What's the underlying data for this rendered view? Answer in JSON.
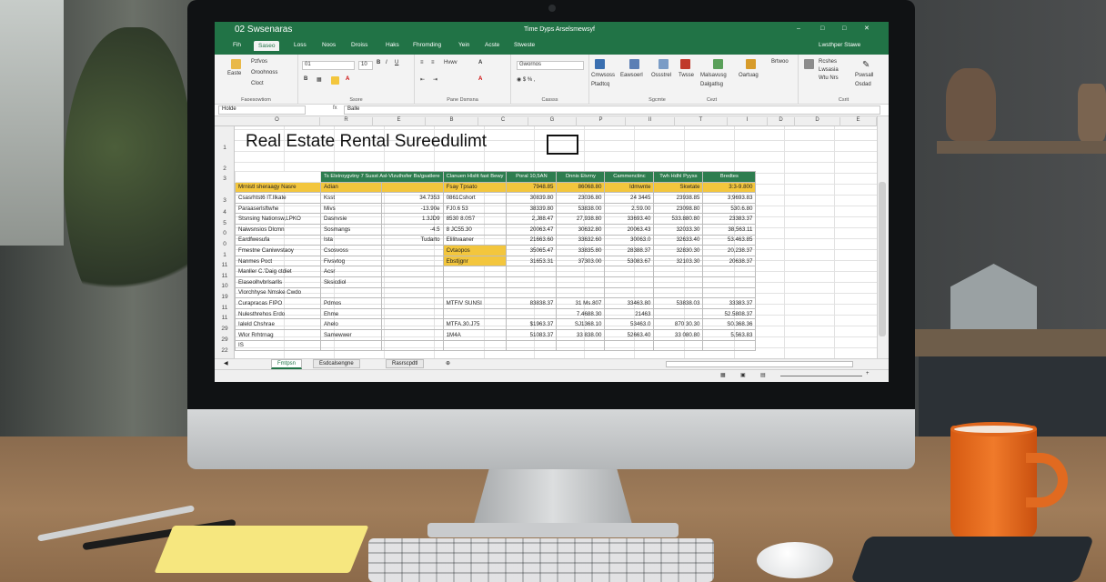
{
  "app": {
    "title": "Time Dyps Arselsmewsyf",
    "quick_access": "02 Swsenaras",
    "account": "Lwsthper Stawe"
  },
  "menu_tabs": [
    "Fih",
    "Saseo",
    "Loss",
    "Noos",
    "Droiss",
    "Haks",
    "Fhromding",
    "Yein",
    "Acste",
    "Stweste"
  ],
  "ribbon": {
    "clipboard": {
      "label": "Faoesowtiom",
      "items": [
        "Easte",
        "Pzfvos",
        "Oroohnoss",
        "Cloct"
      ]
    },
    "font": {
      "label": "Ssore",
      "font_name": "01",
      "font_size": "10"
    },
    "alignment": {
      "label": "Pane Dsmsna",
      "wrap": "Hvwv"
    },
    "number": {
      "label": "Cassss",
      "format": "Gwornos"
    },
    "styles": {
      "label": "Sgcmte",
      "items": [
        "Cmwsoss",
        "Eawsoerl",
        "Ossstrel",
        "Twsse",
        "Malsavusg",
        "Oartuag"
      ]
    },
    "cells": {
      "label": "Cezt",
      "items": [
        "Ptadtcq",
        "Mewssog",
        "Flwasmarso",
        "Dalgatlsg",
        "Brtwoo"
      ]
    },
    "editing": {
      "label": "Csrit",
      "items": [
        "Rcshes",
        "Lwsasia",
        "Wtu Nrs",
        "Pswsall",
        "Osdad"
      ]
    }
  },
  "formula_bar": {
    "name_box": "Holde",
    "fx": "fx",
    "content": "Balle"
  },
  "columns": [
    "O",
    "R",
    "E",
    "B",
    "C",
    "G",
    "P",
    "II",
    "T",
    "I",
    "D",
    "D",
    "E"
  ],
  "rows": [
    "1",
    "2",
    "3",
    "3",
    "4",
    "5",
    "0",
    "0",
    "1",
    "11",
    "11",
    "10",
    "19",
    "11",
    "11",
    "29",
    "29",
    "22"
  ],
  "sheet_title": "Real Estate Rental Sureedulimt",
  "table": {
    "headers": [
      "",
      "Ts Elstroygvtny 7 Susst  Asl-Vlzuthsfer   Bs/gsatlere",
      "Clanuen Hlsltt fast Bewy",
      "Poral 10,5AN",
      "Dnnis Etvrny",
      "Cammenctinc",
      "Twh Hdhl Pyyss",
      "Bredtes"
    ],
    "rows": [
      {
        "hl": true,
        "cells": [
          "Mrnistl sheraagy Nasre",
          "Adian",
          "",
          "Fsay Tpsato",
          "7948.85",
          "86068.80",
          "Idmwnte",
          "Skwtate",
          "3:3-9.800"
        ]
      },
      {
        "hl": false,
        "cells": [
          "Csasrhtst6 IT.Ilkate",
          "Ksst",
          "34.7353",
          "0861Cshort",
          "30839.80",
          "23036.80",
          "24 3445",
          "23938.85",
          "3;9693.83"
        ]
      },
      {
        "hl": false,
        "cells": [
          "Paraaserlsftwhe",
          "Mivs",
          "-13.90e",
          "FJ0.6 53",
          "38339.80",
          "53838.00",
          "2.S9.00",
          "23098.80",
          "530.6.80"
        ]
      },
      {
        "hl": false,
        "cells": [
          "Stsnsing Nationsw,LPKO",
          "Dasnvsie",
          "1.3JD9",
          "8530 8.0S7",
          "2,J88.47",
          "27,938.80",
          "33693.40",
          "533.880.80",
          "23383.37"
        ]
      },
      {
        "hl": false,
        "cells": [
          "Naiwsnsios Dlcmn",
          "Sosmangs",
          "-4.5",
          "8 JC55.30",
          "20063.47",
          "30632.80",
          "20063.43",
          "32033.30",
          "38,563.11"
        ]
      },
      {
        "hl": false,
        "cells": [
          "Eardfwesufa",
          "Ista",
          "Tudarto",
          "Elilitvaaner",
          "21663.60",
          "33632.60",
          "30063.0",
          "32633.40",
          "53.463.85"
        ]
      },
      {
        "hl": false,
        "cells": [
          "Fmestne Caniwvstaoy",
          "Csosvoss",
          "",
          "Cvtaopos",
          "35065.47",
          "33835.80",
          "28388.37",
          "32830.30",
          "20,238.37"
        ]
      },
      {
        "hl": false,
        "cells": [
          "Nanmes Poct",
          "Fivsvtog",
          "",
          "Ebstljgnr",
          "31653.31",
          "37303.00",
          "53083.67",
          "32103.30",
          "20638.37"
        ]
      },
      {
        "hl": false,
        "cells": [
          "Manller C.'Daig ctdiet",
          "Acsr",
          "",
          "",
          "",
          "",
          "",
          "",
          ""
        ]
      },
      {
        "hl": false,
        "cells": [
          "Elaseolhvbrlsarlls",
          "Sksicdiol",
          "",
          "",
          "",
          "",
          "",
          "",
          ""
        ]
      },
      {
        "hl": false,
        "cells": [
          "Vlorchhyse Nmske Cwdo",
          "",
          "",
          "",
          "",
          "",
          "",
          "",
          ""
        ]
      },
      {
        "hl": false,
        "cells": [
          "Curapracas FIPO",
          "Pdmos",
          "",
          "MTFIV SUNSI",
          "83838.37",
          "31 Ms.807",
          "33463.80",
          "53838.03",
          "33383.37"
        ]
      },
      {
        "hl": false,
        "cells": [
          "Nulesthrehos Erdo",
          "Ehme",
          "",
          "",
          "",
          "7.4688.30",
          "21463",
          "",
          "52.5808.37"
        ]
      },
      {
        "hl": false,
        "cells": [
          "Ialeld Chshrae",
          "Ahelo",
          "",
          "MTFA.30.J75",
          "$1963.37",
          "SJ1368.10",
          "53463.0",
          "870 30.30",
          "S0.368.36"
        ]
      },
      {
        "hl": false,
        "cells": [
          "Wlor Rrhtrnag",
          "Samewwer",
          "",
          "1M4A",
          "51083.37",
          "33 838.00",
          "52663.40",
          "33 080.80",
          "5,563.83"
        ]
      },
      {
        "hl": false,
        "cells": [
          "IS",
          "",
          "",
          "",
          "",
          "",
          "",
          "",
          ""
        ]
      }
    ]
  },
  "sheets": [
    "Fmtpsn",
    "Esdcalsengne",
    "Rasrscpdtl"
  ],
  "colors": {
    "excel_green": "#217346",
    "header_green": "#2e7d4f",
    "highlight_yellow": "#f3c63d"
  }
}
